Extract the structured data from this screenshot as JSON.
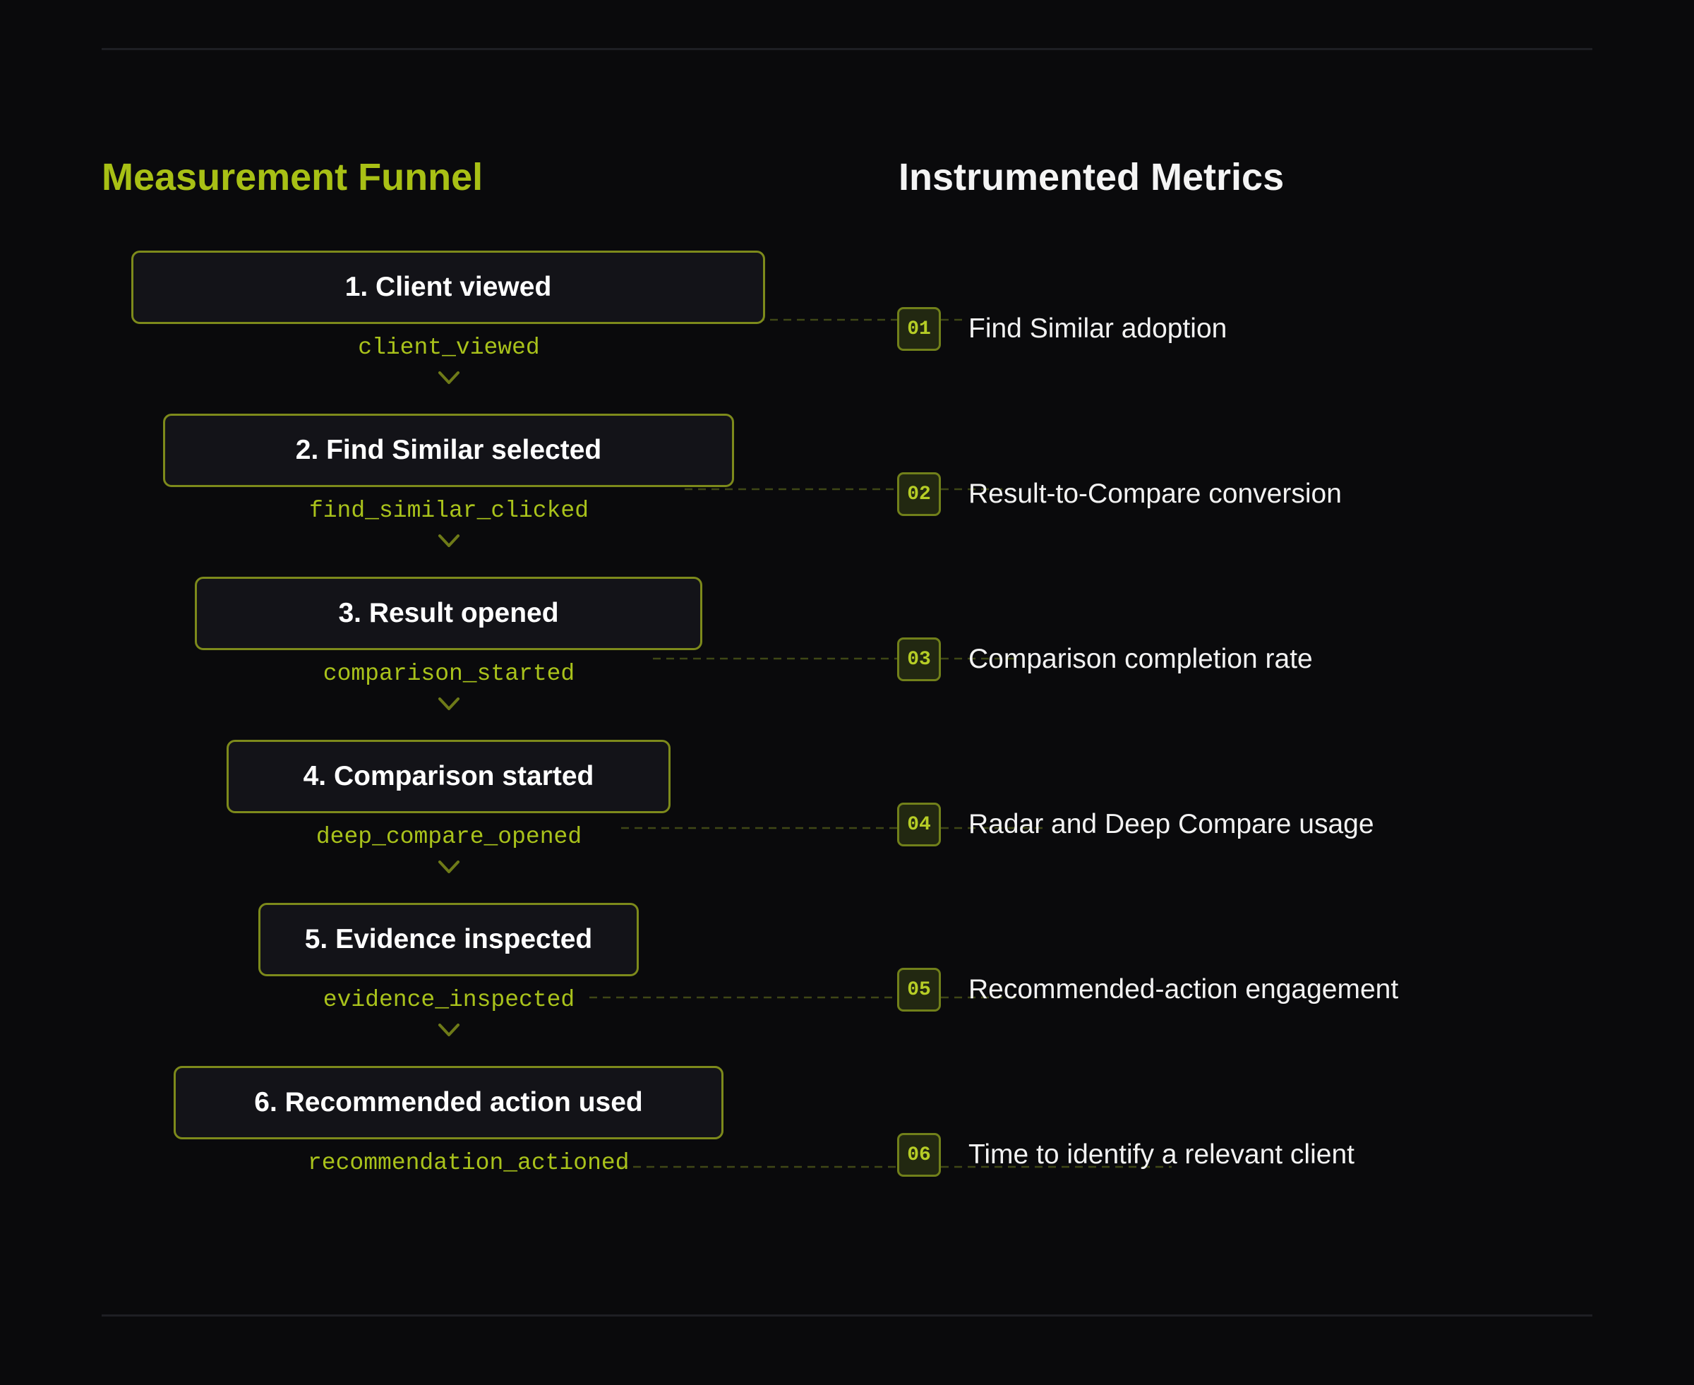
{
  "funnel": {
    "title": "Measurement Funnel",
    "stages": [
      {
        "label": "1. Client viewed",
        "event": "client_viewed"
      },
      {
        "label": "2. Find Similar selected",
        "event": "find_similar_clicked"
      },
      {
        "label": "3. Result opened",
        "event": "comparison_started"
      },
      {
        "label": "4. Comparison started",
        "event": "deep_compare_opened"
      },
      {
        "label": "5. Evidence inspected",
        "event": "evidence_inspected"
      },
      {
        "label": "6. Recommended action used",
        "event": "recommendation_actioned"
      }
    ]
  },
  "metrics": {
    "title": "Instrumented Metrics",
    "items": [
      {
        "number": "01",
        "label": "Find Similar adoption"
      },
      {
        "number": "02",
        "label": "Result-to-Compare conversion"
      },
      {
        "number": "03",
        "label": "Comparison completion rate"
      },
      {
        "number": "04",
        "label": "Radar and Deep Compare usage"
      },
      {
        "number": "05",
        "label": "Recommended-action engagement"
      },
      {
        "number": "06",
        "label": "Time to identify a relevant client"
      }
    ]
  },
  "colors": {
    "background": "#0a0a0c",
    "accent": "#a8c015",
    "box_fill": "#131318",
    "box_border": "#7d8a1b",
    "connector": "#3f4716"
  },
  "icons": {
    "stage_arrow": "chevron-down-icon"
  }
}
